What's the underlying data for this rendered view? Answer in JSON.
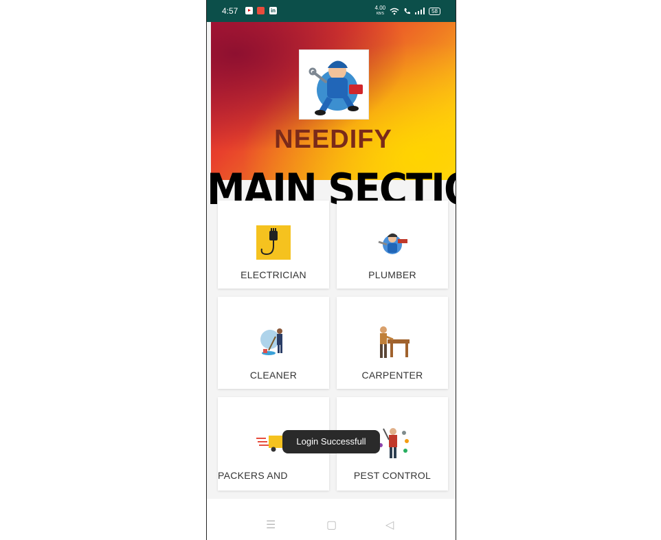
{
  "status_bar": {
    "time": "4:57",
    "net_speed": "4.00",
    "net_unit": "KB/S",
    "battery": "58"
  },
  "app": {
    "brand": "NEEDIFY",
    "overlay_caption": "MAIN SECTION"
  },
  "services": [
    {
      "label": "ELECTRICIAN",
      "icon": "electric-plug-icon"
    },
    {
      "label": "PLUMBER",
      "icon": "plumber-icon"
    },
    {
      "label": "CLEANER",
      "icon": "cleaner-icon"
    },
    {
      "label": "CARPENTER",
      "icon": "carpenter-icon"
    },
    {
      "label": "PACKERS AND",
      "icon": "delivery-truck-icon"
    },
    {
      "label": "PEST CONTROL",
      "icon": "pest-control-icon"
    }
  ],
  "toast": {
    "message": "Login Successfull"
  },
  "nav": {
    "menu": "☰",
    "home": "▢",
    "back": "◁"
  },
  "colors": {
    "status_bar": "#0c4f4a",
    "brand_text": "#7a2a1a",
    "hero_start": "#c2183a",
    "hero_end": "#ffd82a"
  }
}
